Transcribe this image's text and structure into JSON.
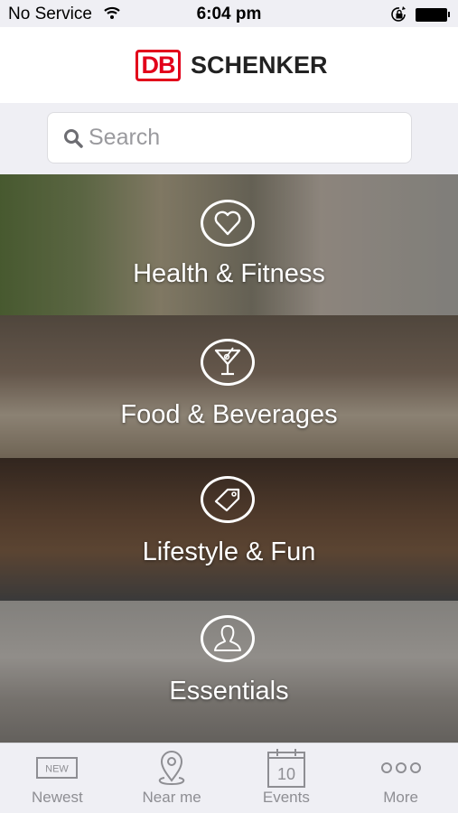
{
  "status_bar": {
    "carrier": "No Service",
    "time": "6:04 pm",
    "icons": [
      "wifi-icon",
      "rotation-lock-icon",
      "battery-icon"
    ]
  },
  "header": {
    "logo_mark": "DB",
    "logo_text": "SCHENKER",
    "brand_color": "#e2001a"
  },
  "search": {
    "placeholder": "Search",
    "value": ""
  },
  "categories": [
    {
      "label": "Health & Fitness",
      "icon": "heart-icon"
    },
    {
      "label": "Food & Beverages",
      "icon": "cocktail-icon"
    },
    {
      "label": "Lifestyle & Fun",
      "icon": "tag-icon"
    },
    {
      "label": "Essentials",
      "icon": "person-icon"
    }
  ],
  "tabbar": {
    "tabs": [
      {
        "label": "Newest",
        "icon": "new-badge-icon",
        "badge_text": "NEW"
      },
      {
        "label": "Near me",
        "icon": "location-pin-icon"
      },
      {
        "label": "Events",
        "icon": "calendar-icon",
        "badge_text": "10"
      },
      {
        "label": "More",
        "icon": "more-dots-icon"
      }
    ]
  }
}
